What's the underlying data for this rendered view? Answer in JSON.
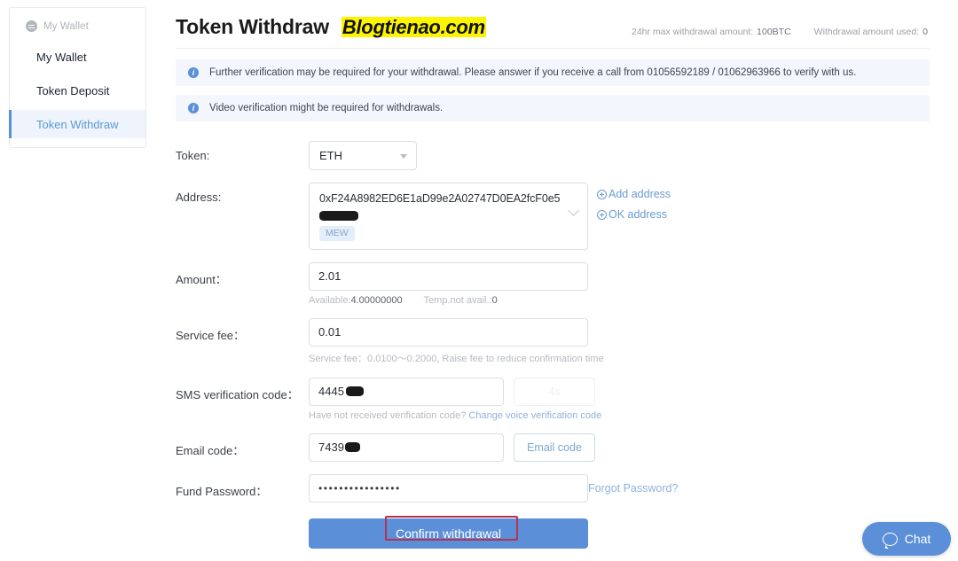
{
  "sidebar": {
    "header_label": "My Wallet",
    "header_icon": "wallet-menu-icon",
    "items": [
      {
        "label": "My Wallet",
        "active": false
      },
      {
        "label": "Token Deposit",
        "active": false
      },
      {
        "label": "Token Withdraw",
        "active": true
      }
    ]
  },
  "header": {
    "title": "Token Withdraw",
    "watermark": "Blogtienao.com",
    "stats": [
      {
        "label": "24hr max withdrawal amount:",
        "value": "100BTC"
      },
      {
        "label": "Withdrawal amount used:",
        "value": "0"
      }
    ]
  },
  "alerts": [
    {
      "icon": "info-icon",
      "text": "Further verification may be required for your withdrawal. Please answer if you receive a call from 01056592189 / 01062963966 to verify with us."
    },
    {
      "icon": "info-icon",
      "text": "Video verification might be required for withdrawals."
    }
  ],
  "form": {
    "token": {
      "label": "Token:",
      "selected": "ETH",
      "options": [
        "ETH"
      ]
    },
    "address": {
      "label": "Address:",
      "value": "0xF24A8982ED6E1aD99e2A02747D0EA2fcF0e5",
      "tag": "MEW",
      "add_address_link": "Add address",
      "ok_address_link": "OK address"
    },
    "amount": {
      "label": "Amount：",
      "value": "2.01",
      "available_label": "Available:",
      "available_value": "4.00000000",
      "temp_label": "Temp.not avail.:",
      "temp_value": "0"
    },
    "service_fee": {
      "label": "Service fee：",
      "value": "0.01",
      "helper": "Service fee：0.0100～0.2000, Raise fee to reduce confirmation time"
    },
    "sms_code": {
      "label": "SMS verification code：",
      "value": "4445",
      "countdown_button": "4s",
      "helper_text": "Have not received verification code?",
      "helper_link": "Change voice verification code"
    },
    "email_code": {
      "label": "Email code：",
      "value": "7439",
      "button": "Email code"
    },
    "fund_password": {
      "label": "Fund Password：",
      "value": "••••••••••••••••",
      "forgot_link": "Forgot Password?"
    },
    "submit_button": "Confirm withdrawal"
  },
  "chat": {
    "label": "Chat",
    "icon": "chat-bubble-icon"
  },
  "colors": {
    "accent_blue": "#5b8fd8",
    "link_blue": "#8fb3da",
    "alert_bg": "#f3f6fd",
    "watermark_yellow": "#fdf500",
    "annotation_red": "#b8324f"
  }
}
